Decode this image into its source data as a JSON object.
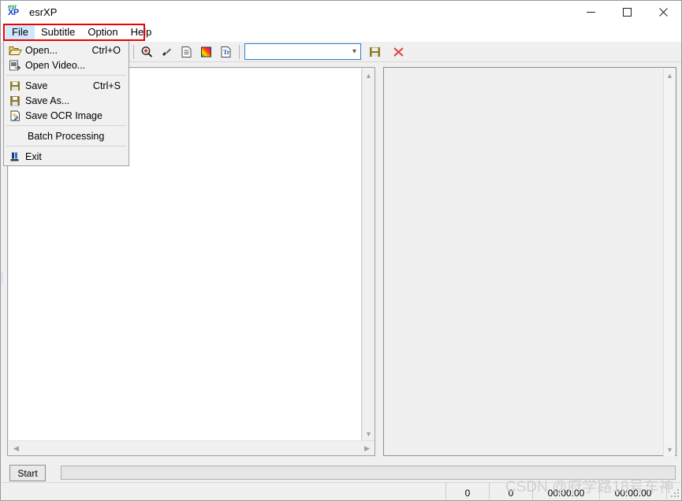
{
  "window": {
    "title": "esrXP",
    "icon_name": "esrxp-logo-icon",
    "icon_text_top": "esr",
    "icon_text_bottom": "XP",
    "controls": [
      {
        "name": "minimize-button",
        "glyph": "minimize-icon"
      },
      {
        "name": "maximize-button",
        "glyph": "maximize-icon"
      },
      {
        "name": "close-button",
        "glyph": "close-icon"
      }
    ]
  },
  "menubar": {
    "items": [
      {
        "label": "File",
        "active": true
      },
      {
        "label": "Subtitle",
        "active": false
      },
      {
        "label": "Option",
        "active": false
      },
      {
        "label": "Help",
        "active": false
      }
    ],
    "annotation_color": "#ee0000"
  },
  "file_menu": {
    "open": true,
    "items": [
      {
        "type": "item",
        "label": "Open...",
        "accel": "Ctrl+O",
        "icon": "open-folder-icon"
      },
      {
        "type": "item",
        "label": "Open Video...",
        "accel": "",
        "icon": "open-video-icon"
      },
      {
        "type": "separator"
      },
      {
        "type": "item",
        "label": "Save",
        "accel": "Ctrl+S",
        "icon": "save-floppy-icon"
      },
      {
        "type": "item",
        "label": "Save As...",
        "accel": "",
        "icon": "save-as-floppy-icon"
      },
      {
        "type": "item",
        "label": "Save OCR Image",
        "accel": "",
        "icon": "save-ocr-image-icon"
      },
      {
        "type": "separator"
      },
      {
        "type": "item",
        "label": "Batch Processing",
        "accel": "",
        "icon": ""
      },
      {
        "type": "separator"
      },
      {
        "type": "item",
        "label": "Exit",
        "accel": "",
        "icon": "exit-icon"
      }
    ]
  },
  "toolbar": {
    "buttons": [
      {
        "name": "open-toolbar-button",
        "icon": "open-folder-icon"
      },
      {
        "name": "open-video-toolbar-button",
        "icon": "open-video-icon"
      },
      {
        "name": "save-toolbar-button",
        "icon": "save-floppy-icon"
      },
      {
        "name": "magnifier-toolbar-button",
        "icon": "magnifier-icon"
      },
      {
        "name": "edit-subtitle-toolbar-button",
        "icon": "edit-page-icon"
      },
      {
        "name": "screen-toolbar-button",
        "icon": "screen-icon"
      },
      {
        "name": "zoom-in-toolbar-button",
        "icon": "zoom-in-icon"
      },
      {
        "name": "eyedropper-toolbar-button",
        "icon": "eyedropper-icon"
      },
      {
        "name": "document-toolbar-button",
        "icon": "document-icon"
      },
      {
        "name": "palette-toolbar-button",
        "icon": "color-palette-icon"
      },
      {
        "name": "text-document-toolbar-button",
        "icon": "text-document-icon"
      }
    ],
    "combo": {
      "value": "",
      "placeholder": ""
    },
    "save-combo-button": {
      "name": "save-combo-button",
      "icon": "save-floppy-icon"
    },
    "delete-combo-button": {
      "name": "delete-combo-button",
      "icon": "red-x-icon"
    }
  },
  "workspace": {
    "left_panel": {
      "name": "image-preview-panel",
      "content": ""
    },
    "right_panel": {
      "name": "subtitle-list-panel",
      "content": ""
    }
  },
  "bottom": {
    "start_button_label": "Start",
    "progress_value": ""
  },
  "statusbar": {
    "message": "",
    "cells": [
      {
        "name": "status-count-1",
        "value": "0"
      },
      {
        "name": "status-count-2",
        "value": "0"
      },
      {
        "name": "status-time-start",
        "value": "00:00:00"
      },
      {
        "name": "status-time-end",
        "value": "00:00:00"
      }
    ]
  },
  "watermark": {
    "text": "CSDN @府学路18号车神"
  }
}
